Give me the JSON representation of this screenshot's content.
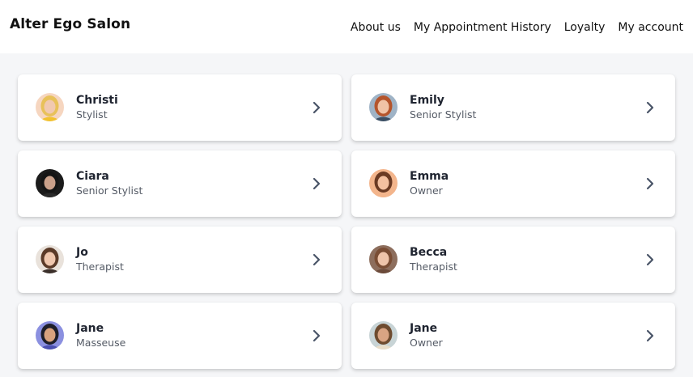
{
  "header": {
    "brand": "Alter Ego Salon",
    "nav": [
      "About us",
      "My Appointment History",
      "Loyalty",
      "My account"
    ]
  },
  "staff": [
    {
      "name": "Christi",
      "role": "Stylist",
      "avatar_bg": "#f6d6c0",
      "hair": "#e8c15a",
      "skin": "#f1c9b0",
      "top": "#f2c230"
    },
    {
      "name": "Emily",
      "role": "Senior Stylist",
      "avatar_bg": "#9fb3c6",
      "hair": "#b5552c",
      "skin": "#f0c3a6",
      "top": "#3b4e63"
    },
    {
      "name": "Ciara",
      "role": "Senior Stylist",
      "avatar_bg": "#1b1b1b",
      "hair": "#151515",
      "skin": "#caa08a",
      "top": "#2a2a2a"
    },
    {
      "name": "Emma",
      "role": "Owner",
      "avatar_bg": "#f3b58c",
      "hair": "#6a3a23",
      "skin": "#f3c0a0",
      "top": "#f3b58c"
    },
    {
      "name": "Jo",
      "role": "Therapist",
      "avatar_bg": "#e9e2db",
      "hair": "#5a3a28",
      "skin": "#efc7ae",
      "top": "#3b2f2a"
    },
    {
      "name": "Becca",
      "role": "Therapist",
      "avatar_bg": "#8d6e5d",
      "hair": "#7a4d34",
      "skin": "#efc4aa",
      "top": "#6b4a3a"
    },
    {
      "name": "Jane",
      "role": "Masseuse",
      "avatar_bg": "#8b90e0",
      "hair": "#1e1e2a",
      "skin": "#d9a27e",
      "top": "#4a4fb0"
    },
    {
      "name": "Jane",
      "role": "Owner",
      "avatar_bg": "#c8d4d6",
      "hair": "#6e4b2f",
      "skin": "#d9a483",
      "top": "#e9ddc9"
    }
  ],
  "chevron_color": "#4a5568"
}
